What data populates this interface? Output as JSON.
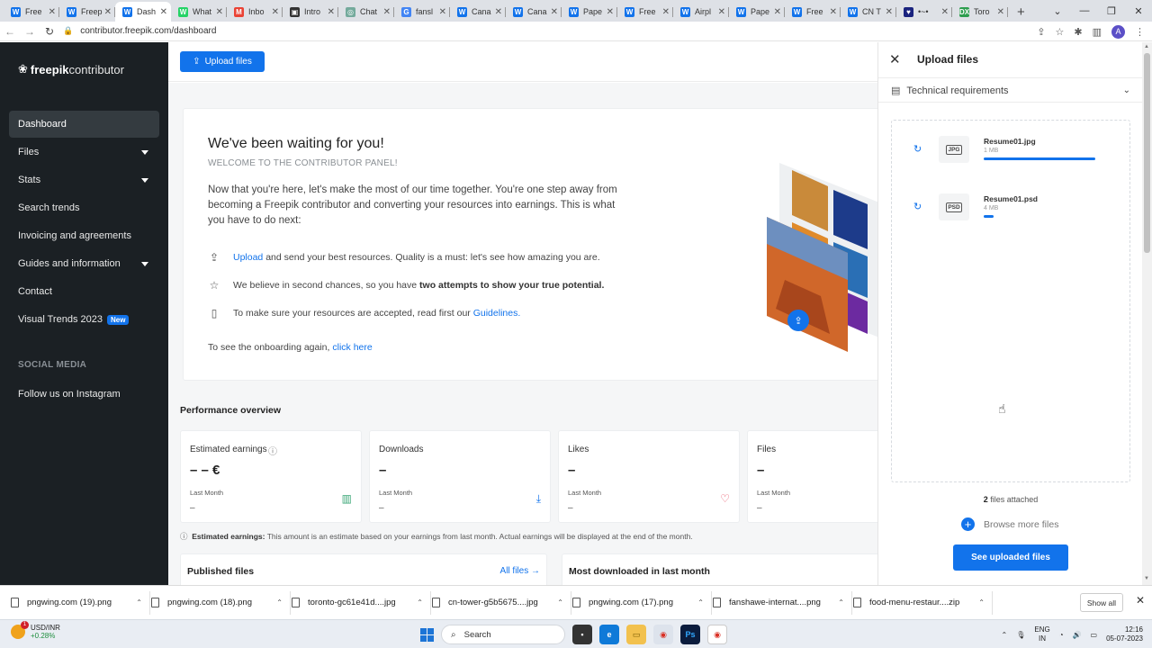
{
  "browser": {
    "tabs": [
      {
        "label": "Free",
        "color": "#1273eb",
        "glyph": "W"
      },
      {
        "label": "Freep",
        "color": "#1273eb",
        "glyph": "W"
      },
      {
        "label": "Dash",
        "color": "#1273eb",
        "glyph": "W",
        "active": true
      },
      {
        "label": "What",
        "color": "#25d366",
        "glyph": "W"
      },
      {
        "label": "Inbo",
        "color": "#ea4335",
        "glyph": "M"
      },
      {
        "label": "Intro",
        "color": "#333333",
        "glyph": "▣"
      },
      {
        "label": "Chat",
        "color": "#74aa9c",
        "glyph": "◎"
      },
      {
        "label": "fansl",
        "color": "#4285f4",
        "glyph": "G"
      },
      {
        "label": "Cana",
        "color": "#1273eb",
        "glyph": "W"
      },
      {
        "label": "Cana",
        "color": "#1273eb",
        "glyph": "W"
      },
      {
        "label": "Pape",
        "color": "#1273eb",
        "glyph": "W"
      },
      {
        "label": "Free",
        "color": "#1273eb",
        "glyph": "W"
      },
      {
        "label": "Airpl",
        "color": "#1273eb",
        "glyph": "W"
      },
      {
        "label": "Pape",
        "color": "#1273eb",
        "glyph": "W"
      },
      {
        "label": "Free",
        "color": "#1273eb",
        "glyph": "W"
      },
      {
        "label": "CN T",
        "color": "#1273eb",
        "glyph": "W"
      },
      {
        "label": "•~•",
        "color": "#1a237e",
        "glyph": "♥"
      },
      {
        "label": "Toro",
        "color": "#2e9e4f",
        "glyph": "DX"
      }
    ],
    "new_tab": "+",
    "url": "contributor.freepik.com/dashboard"
  },
  "sidebar": {
    "logo_bold": "freepik",
    "logo_light": "contributor",
    "items": [
      {
        "label": "Dashboard",
        "active": true
      },
      {
        "label": "Files",
        "caret": true
      },
      {
        "label": "Stats",
        "caret": true
      },
      {
        "label": "Search trends"
      },
      {
        "label": "Invoicing and agreements"
      },
      {
        "label": "Guides and information",
        "caret": true
      },
      {
        "label": "Contact"
      },
      {
        "label": "Visual Trends 2023",
        "badge": "New"
      }
    ],
    "social_heading": "SOCIAL MEDIA",
    "social_item": "Follow us on Instagram"
  },
  "topbar": {
    "upload_label": "Upload files"
  },
  "welcome": {
    "title": "We've been waiting for you!",
    "subtitle": "WELCOME TO THE CONTRIBUTOR PANEL!",
    "body": "Now that you're here, let's make the most of our time together. You're one step away from becoming a Freepik contributor and converting your resources into earnings. This is what you have to do next:",
    "b1_link": "Upload",
    "b1_text": " and send your best resources. Quality is a must: let's see how amazing you are.",
    "b2_text": "We believe in second chances, so you have ",
    "b2_bold": "two attempts to show your true potential.",
    "b3_text": "To make sure your resources are accepted, read first our ",
    "b3_link": "Guidelines.",
    "onboard_text": "To see the onboarding again, ",
    "onboard_link": "click here"
  },
  "performance": {
    "title": "Performance overview",
    "cards": [
      {
        "title": "Estimated earnings",
        "value": "– – €",
        "period": "Last Month",
        "delta": "–",
        "icon": "bar-chart-icon",
        "icon_color": "#3aa676"
      },
      {
        "title": "Downloads",
        "value": "–",
        "period": "Last Month",
        "delta": "–",
        "icon": "download-icon",
        "icon_color": "#1273eb"
      },
      {
        "title": "Likes",
        "value": "–",
        "period": "Last Month",
        "delta": "–",
        "icon": "heart-icon",
        "icon_color": "#e63e55"
      },
      {
        "title": "Files",
        "value": "–",
        "period": "Last Month",
        "delta": "–",
        "icon": "",
        "icon_color": ""
      }
    ],
    "disclaimer_bold": "Estimated earnings:",
    "disclaimer_text": " This amount is an estimate based on your earnings from last month. Actual earnings will be displayed at the end of the month."
  },
  "sections": {
    "published": "Published files",
    "all_files": "All files",
    "most_downloaded": "Most downloaded in last month"
  },
  "upload_panel": {
    "title": "Upload files",
    "tech": "Technical requirements",
    "files": [
      {
        "name": "Resume01.jpg",
        "size": "1 MB",
        "type": "JPG",
        "progress": 1.0
      },
      {
        "name": "Resume01.psd",
        "size": "4 MB",
        "type": "PSD",
        "progress": 0.09
      }
    ],
    "attached_count": "2",
    "attached_text": " files attached",
    "browse": "Browse more files",
    "see_uploaded": "See uploaded files"
  },
  "downloads": {
    "items": [
      "pngwing.com (19).png",
      "pngwing.com (18).png",
      "toronto-gc61e41d....jpg",
      "cn-tower-g5b5675....jpg",
      "pngwing.com (17).png",
      "fanshawe-internat....png",
      "food-menu-restaur....zip"
    ],
    "show_all": "Show all"
  },
  "taskbar": {
    "stock_name": "USD/INR",
    "stock_change": "+0.28%",
    "search": "Search",
    "lang_top": "ENG",
    "lang_bottom": "IN",
    "time": "12:16",
    "date": "05-07-2023",
    "notification": "1"
  },
  "colors": {
    "accent": "#1273eb",
    "sidebar": "#1b2024"
  }
}
